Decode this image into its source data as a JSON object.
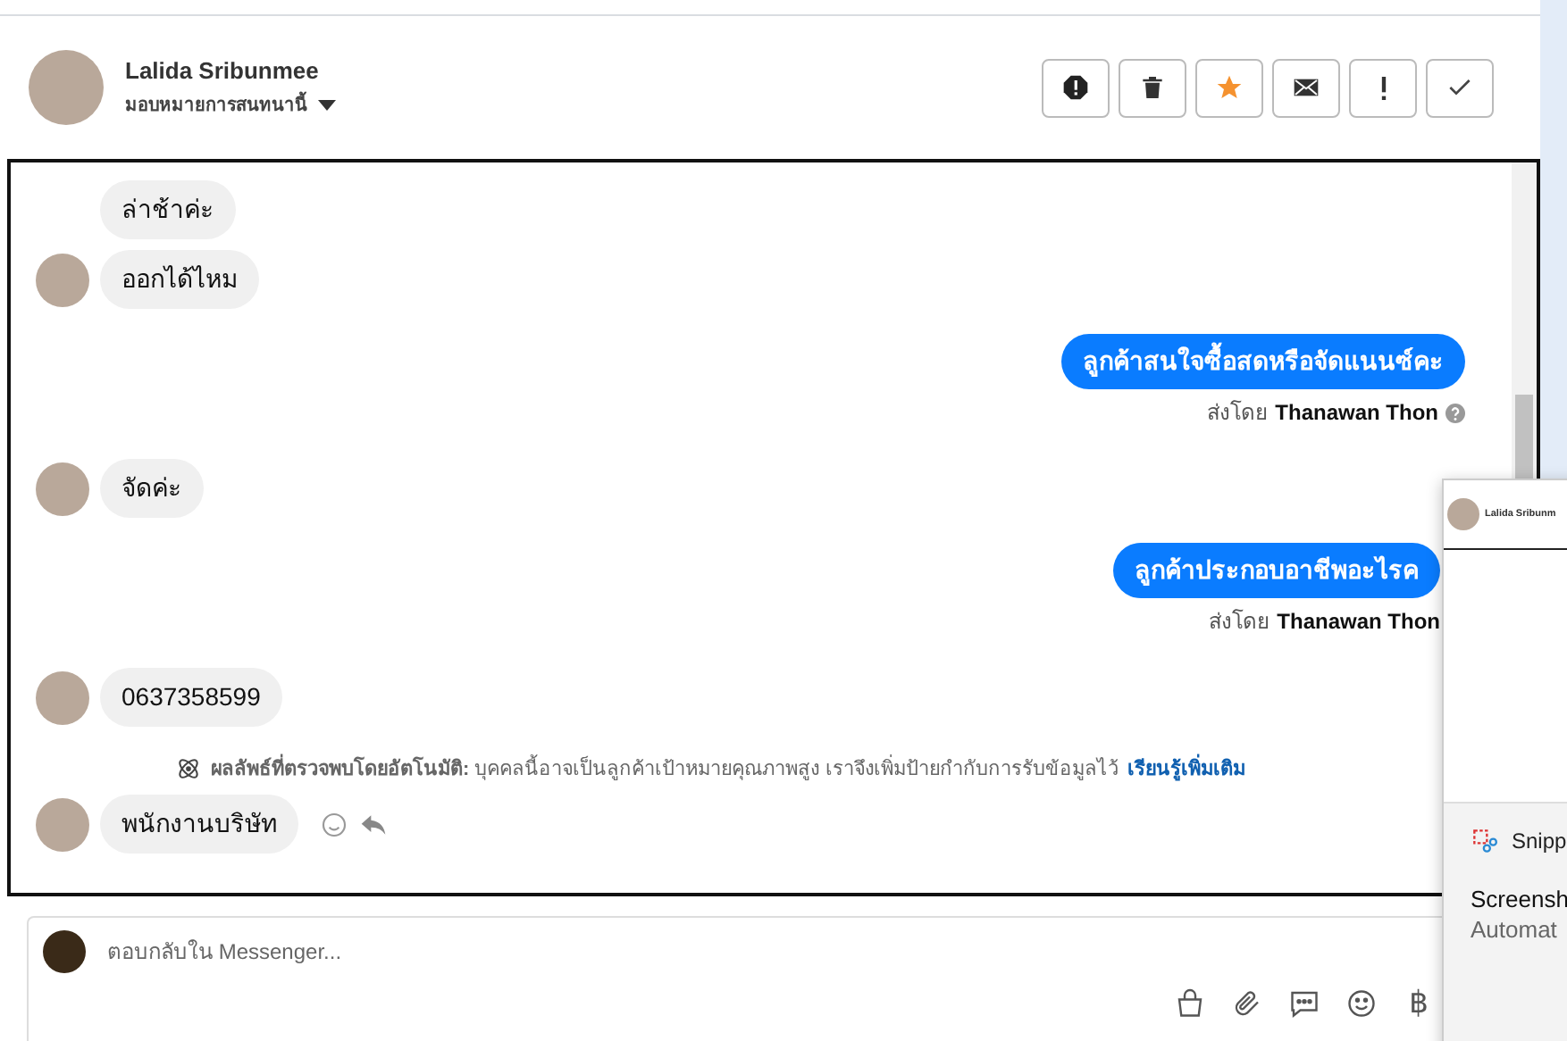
{
  "header": {
    "name": "Lalida Sribunmee",
    "assign_label": "มอบหมายการสนทนานี้",
    "actions": [
      {
        "kind": "alert"
      },
      {
        "kind": "trash"
      },
      {
        "kind": "star",
        "on": true
      },
      {
        "kind": "mail"
      },
      {
        "kind": "exclaim"
      },
      {
        "kind": "check"
      }
    ]
  },
  "messages": [
    {
      "kind": "incoming",
      "text": "ล่าช้าค่ะ",
      "avatar": false
    },
    {
      "kind": "incoming",
      "text": "ออกได้ไหม",
      "avatar": true
    },
    {
      "kind": "outgoing",
      "text": "ลูกค้าสนใจซื้อสดหรือจัดแนนซ์คะ",
      "sent_prefix": "ส่งโดย",
      "sent_by": "Thanawan Thon",
      "help": true
    },
    {
      "kind": "incoming",
      "text": "จัดค่ะ",
      "avatar": true
    },
    {
      "kind": "outgoing",
      "text": "ลูกค้าประกอบอาชีพอะไรค",
      "sent_prefix": "ส่งโดย",
      "sent_by": "Thanawan Thon",
      "help": false
    },
    {
      "kind": "incoming",
      "text": "0637358599",
      "avatar": true
    },
    {
      "kind": "notice",
      "text": "**ผลลัพธ์ที่ตรวจพบโดยอัตโนมัติ:** บุคคลนี้อาจเป็นลูกค้าเป้าหมายคุณภาพสูง เราจึงเพิ่มป้ายกำกับการรับข้อมูลไว้",
      "link": "เรียนรู้เพิ่มเติม"
    },
    {
      "kind": "incoming",
      "text": "พนักงานบริษัท",
      "avatar": true,
      "reactions": true
    }
  ],
  "composer": {
    "placeholder": "ตอบกลับใน Messenger...",
    "tools": [
      {
        "kind": "bag"
      },
      {
        "kind": "clip"
      },
      {
        "kind": "chat"
      },
      {
        "kind": "smile"
      },
      {
        "kind": "baht",
        "text": "฿"
      }
    ]
  },
  "notification": {
    "preview_name": "Lalida Sribunm",
    "app": "Snipp",
    "title": "Screensh",
    "body": "Automat"
  }
}
